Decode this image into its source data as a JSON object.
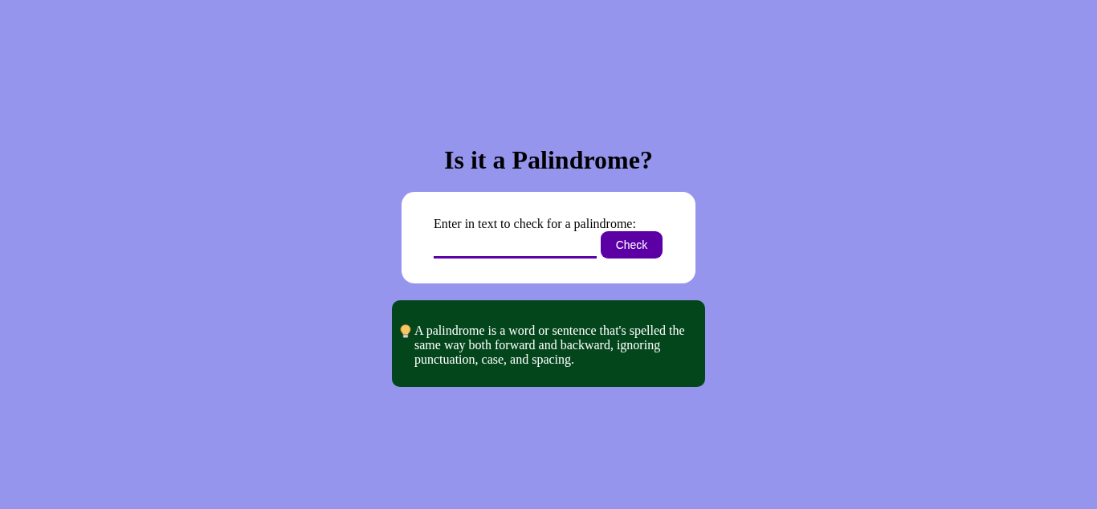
{
  "title": "Is it a Palindrome?",
  "form": {
    "label": "Enter in text to check for a palindrome:",
    "button": "Check"
  },
  "info": {
    "text": "A palindrome is a word or sentence that's spelled the same way both forward and backward, ignoring punctuation, case, and spacing."
  }
}
